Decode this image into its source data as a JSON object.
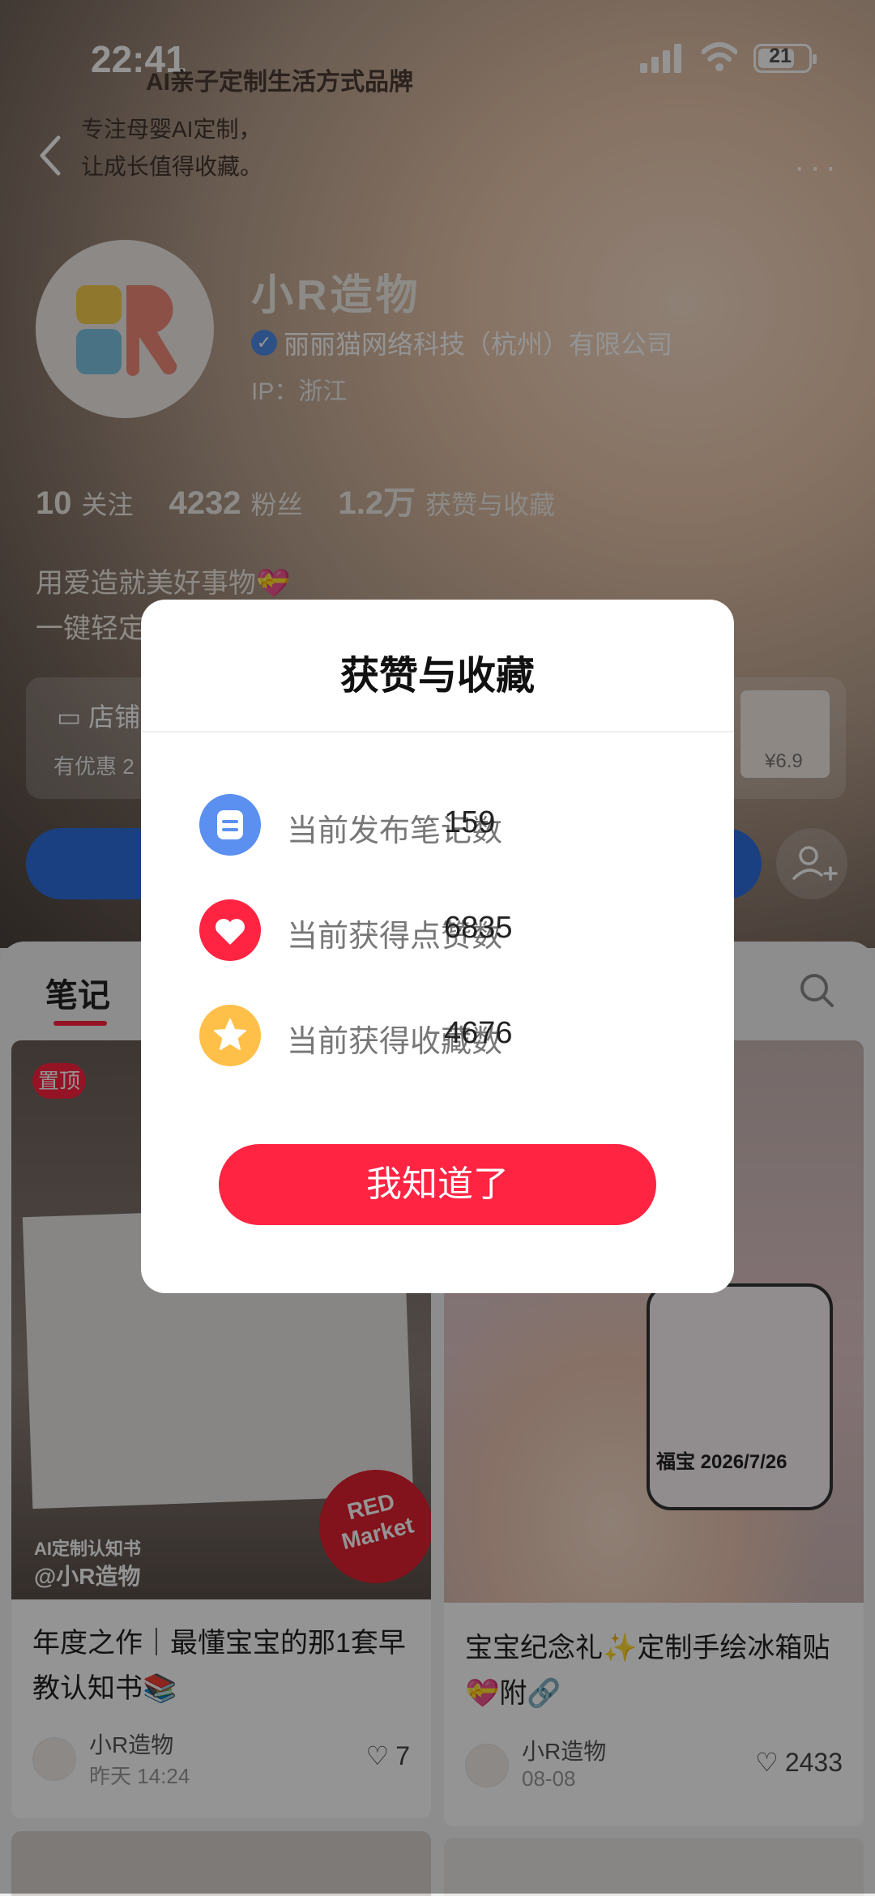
{
  "status_bar": {
    "time": "22:41",
    "battery": "21"
  },
  "header": {
    "brand_line": "AI亲子定制生活方式品牌",
    "intro_line1": "专注母婴AI定制，",
    "intro_line2": "让成长值得收藏。"
  },
  "profile": {
    "nickname": "小R造物",
    "company": "丽丽猫网络科技（杭州）有限公司",
    "ip": "IP：浙江",
    "stats": [
      {
        "value": "10",
        "label": "关注"
      },
      {
        "value": "4232",
        "label": "粉丝"
      },
      {
        "value": "1.2万",
        "label": "获赞与收藏"
      }
    ],
    "bio_line1": "用爱造就美好事物💝",
    "bio_line2": "一键轻定"
  },
  "shop": {
    "title": "店铺",
    "subtitle": "有优惠 2",
    "thumb_price": "¥6.9"
  },
  "tabs": {
    "notes": "笔记"
  },
  "cards": [
    {
      "badge": "置顶",
      "overlay_tag": "AI定制认知书",
      "overlay_handle": "@小R造物",
      "stamp": "RED Market",
      "title": "年度之作｜最懂宝宝的那1套早教认知书📚",
      "author": "小R造物",
      "date": "昨天 14:24",
      "likes": "7"
    },
    {
      "sticker_text": "福宝 2026/7/26",
      "title": "宝宝纪念礼✨定制手绘冰箱贴💝附🔗",
      "author": "小R造物",
      "date": "08-08",
      "likes": "2433"
    }
  ],
  "modal": {
    "title": "获赞与收藏",
    "rows": [
      {
        "icon": "note-icon",
        "label": "当前发布笔记数",
        "value": "159"
      },
      {
        "icon": "heart-icon",
        "label": "当前获得点赞数",
        "value": "6835"
      },
      {
        "icon": "star-icon",
        "label": "当前获得收藏数",
        "value": "4676"
      }
    ],
    "button": "我知道了"
  },
  "colors": {
    "accent": "#ff2442",
    "note_blue": "#5b8ff0",
    "fav_yellow": "#ffc04a",
    "follow_blue": "#2d6fe0"
  }
}
